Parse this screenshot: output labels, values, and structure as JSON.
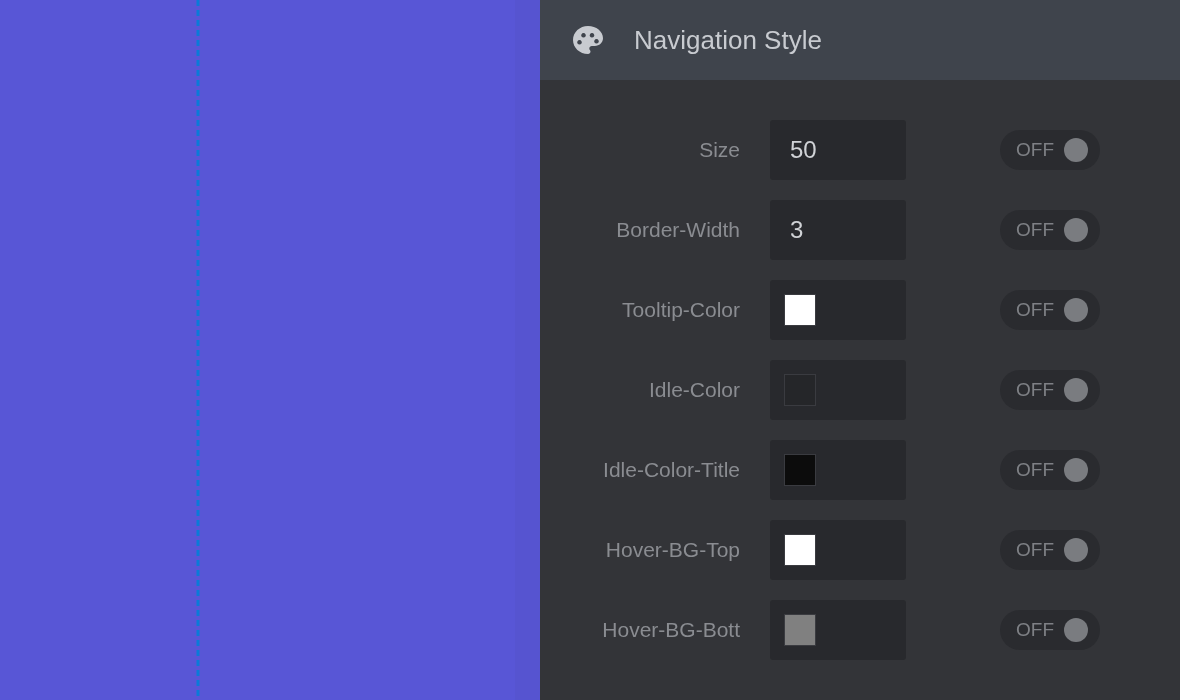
{
  "panel": {
    "title": "Navigation Style"
  },
  "rows": [
    {
      "label": "Size",
      "kind": "number",
      "value": "50",
      "toggle": {
        "text": "OFF",
        "on": false
      }
    },
    {
      "label": "Border-Width",
      "kind": "number",
      "value": "3",
      "toggle": {
        "text": "OFF",
        "on": false
      }
    },
    {
      "label": "Tooltip-Color",
      "kind": "color",
      "color": "#ffffff",
      "toggle": {
        "text": "OFF",
        "on": false
      }
    },
    {
      "label": "Idle-Color",
      "kind": "color",
      "color": "#252629",
      "toggle": {
        "text": "OFF",
        "on": false
      }
    },
    {
      "label": "Idle-Color-Title",
      "kind": "color",
      "color": "#0c0c0c",
      "toggle": {
        "text": "OFF",
        "on": false
      }
    },
    {
      "label": "Hover-BG-Top",
      "kind": "color",
      "color": "#ffffff",
      "toggle": {
        "text": "OFF",
        "on": false
      }
    },
    {
      "label": "Hover-BG-Bott",
      "kind": "color",
      "color": "#808080",
      "toggle": {
        "text": "OFF",
        "on": false
      }
    }
  ]
}
